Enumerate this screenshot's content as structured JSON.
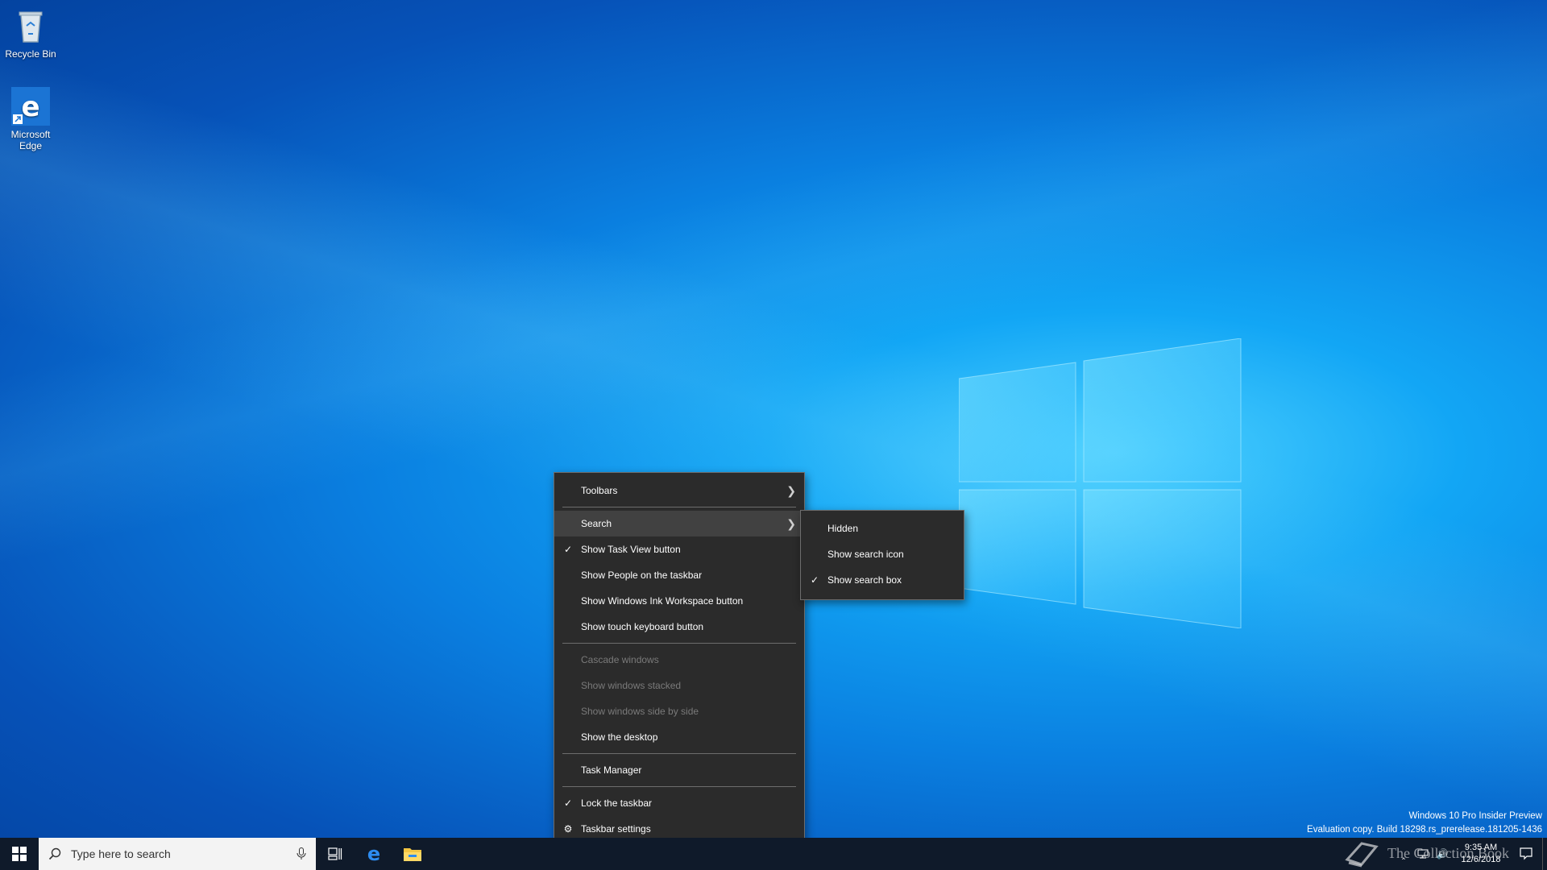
{
  "desktop": {
    "icons": [
      {
        "label": "Recycle Bin",
        "icon": "recycle-bin-icon"
      },
      {
        "label": "Microsoft Edge",
        "icon": "edge-icon"
      }
    ]
  },
  "context_menu": {
    "items": [
      {
        "label": "Toolbars",
        "has_submenu": true,
        "checked": false,
        "disabled": false
      },
      {
        "label": "Search",
        "has_submenu": true,
        "checked": false,
        "disabled": false,
        "highlighted": true
      },
      {
        "label": "Show Task View button",
        "checked": true
      },
      {
        "label": "Show People on the taskbar",
        "checked": false
      },
      {
        "label": "Show Windows Ink Workspace button",
        "checked": false
      },
      {
        "label": "Show touch keyboard button",
        "checked": false
      },
      {
        "label": "Cascade windows",
        "disabled": true
      },
      {
        "label": "Show windows stacked",
        "disabled": true
      },
      {
        "label": "Show windows side by side",
        "disabled": true
      },
      {
        "label": "Show the desktop",
        "disabled": false
      },
      {
        "label": "Task Manager",
        "disabled": false
      },
      {
        "label": "Lock the taskbar",
        "checked": true
      },
      {
        "label": "Taskbar settings",
        "icon": "gear-icon"
      }
    ]
  },
  "search_submenu": {
    "items": [
      {
        "label": "Hidden",
        "checked": false
      },
      {
        "label": "Show search icon",
        "checked": false
      },
      {
        "label": "Show search box",
        "checked": true
      }
    ]
  },
  "taskbar": {
    "search_placeholder": "Type here to search",
    "pinned": [
      "task-view-icon",
      "edge-icon",
      "file-explorer-icon"
    ],
    "clock_time": "9:35 AM",
    "clock_date": "12/6/2018"
  },
  "watermark": {
    "line1": "Windows 10 Pro Insider Preview",
    "line2": "Evaluation copy. Build 18298.rs_prerelease.181205-1436"
  },
  "brand": "The Collection Book",
  "colors": {
    "menu_bg": "#2b2b2b",
    "menu_hover": "#414141",
    "taskbar_bg": "#0f1a2a",
    "desktop_accent": "#12a6f5"
  }
}
